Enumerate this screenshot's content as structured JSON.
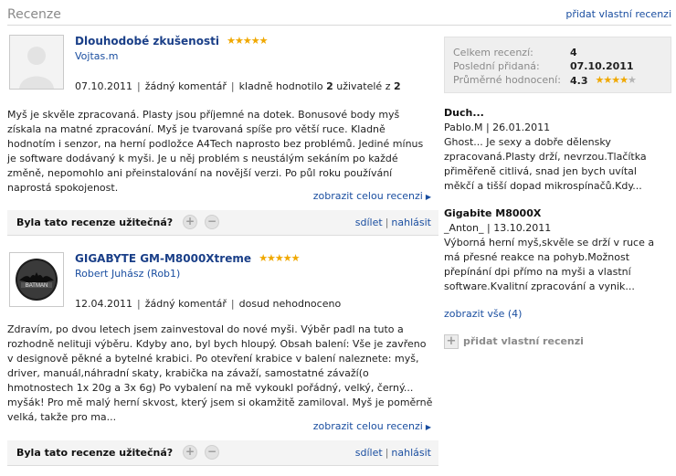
{
  "header": {
    "title": "Recenze",
    "add_link": "přidat vlastní recenzi"
  },
  "reviews": [
    {
      "title": "Dlouhodobé zkušenosti",
      "stars": "★★★★★",
      "author": "Vojtas.m",
      "date": "07.10.2011",
      "comments": "žádný komentář",
      "rating_prefix": "kladně hodnotilo",
      "rating_count": "2",
      "rating_mid": "uživatelé z",
      "rating_total": "2",
      "avatar_icon": "user-silhouette-icon",
      "body": "Myš je skvěle zpracovaná. Plasty jsou příjemné na dotek. Bonusové body myš získala na matné zpracování. Myš je tvarovaná spíše pro větší ruce. Kladně hodnotím i senzor, na herní podložce A4Tech naprosto bez problémů. Jediné mínus je software dodávaný k myši. Je u něj problém s neustálým sekáním po každé změně, nepomohlo ani přeinstalování na novější verzi. Po půl roku používání naprostá spokojenost.",
      "more": "zobrazit celou recenzi",
      "useful_q": "Byla tato recenze užitečná?",
      "share": "sdílet",
      "report": "nahlásit"
    },
    {
      "title": "GIGABYTE GM-M8000Xtreme",
      "stars": "★★★★★",
      "author": "Robert Juhász (Rob1)",
      "date": "12.04.2011",
      "comments": "žádný komentář",
      "rating_text": "dosud nehodnoceno",
      "avatar_icon": "batman-logo-icon",
      "body": "Zdravím, po dvou letech jsem zainvestoval do nové myši. Výběr padl na tuto a rozhodně nelituji výběru. Kdyby ano, byl bych hloupý. Obsah balení: Vše je zavřeno v designově pěkné a bytelné krabici. Po otevření krabice v balení naleznete: myš, driver, manuál,náhradní skaty, krabička na závaží, samostatné závaží(o hmotnostech 1x 20g a 3x 6g) Po vybalení na mě vykoukl pořádný, velký, černý... myšák! Pro mě malý herní skvost, který jsem si okamžitě zamiloval. Myš je poměrně velká, takže pro ma...",
      "more": "zobrazit celou recenzi",
      "useful_q": "Byla tato recenze užitečná?",
      "share": "sdílet",
      "report": "nahlásit"
    }
  ],
  "stats": {
    "total_label": "Celkem recenzí:",
    "total_value": "4",
    "last_label": "Poslední přidaná:",
    "last_value": "07.10.2011",
    "avg_label": "Průměrné hodnocení:",
    "avg_value": "4.3",
    "avg_stars": "★★★★",
    "avg_star_empty": "★"
  },
  "side_reviews": [
    {
      "title": "Duch...",
      "meta": "Pablo.M | 26.01.2011",
      "excerpt": "Ghost... Je sexy a dobře dělensky zpracovaná.Plasty drží, nevrzou.Tlačítka přiměřeně citlivá, snad jen bych uvítal měkčí a tišší dopad mikrospínačů.Kdy..."
    },
    {
      "title": "Gigabite M8000X",
      "meta": "_Anton_ | 13.10.2011",
      "excerpt": "Výborná herní myš,skvěle se drží v ruce a má přesné reakce na pohyb.Možnost přepínání dpi přímo na myši a vlastní software.Kvalitní zpracování a vynik..."
    }
  ],
  "show_all": "zobrazit vše (4)",
  "add_own": "přidat vlastní recenzi",
  "colors": {
    "link": "#1a4ea0",
    "title": "#1a3f88",
    "star": "#f0a800",
    "muted": "#8a8a8a"
  }
}
